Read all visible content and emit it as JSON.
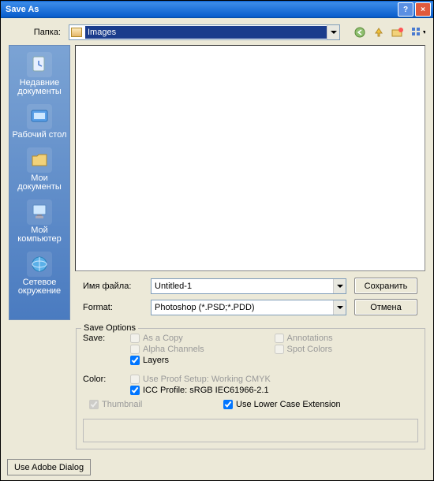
{
  "title": "Save As",
  "path_label": "Папка:",
  "path_value": "Images",
  "places": [
    {
      "label": "Недавние документы"
    },
    {
      "label": "Рабочий стол"
    },
    {
      "label": "Мои документы"
    },
    {
      "label": "Мой компьютер"
    },
    {
      "label": "Сетевое окружение"
    }
  ],
  "filename_label": "Имя файла:",
  "filename_value": "Untitled-1",
  "format_label": "Format:",
  "format_value": "Photoshop (*.PSD;*.PDD)",
  "save_btn": "Сохранить",
  "cancel_btn": "Отмена",
  "saveopts_legend": "Save Options",
  "save_label": "Save:",
  "as_copy": "As a Copy",
  "alpha_channels": "Alpha Channels",
  "layers": "Layers",
  "annotations": "Annotations",
  "spot_colors": "Spot Colors",
  "color_label": "Color:",
  "proof_setup": "Use Proof Setup:   Working CMYK",
  "icc_profile": "ICC Profile:  sRGB IEC61966-2.1",
  "thumbnail": "Thumbnail",
  "lowercase_ext": "Use Lower Case Extension",
  "adobe_dialog_btn": "Use Adobe Dialog"
}
